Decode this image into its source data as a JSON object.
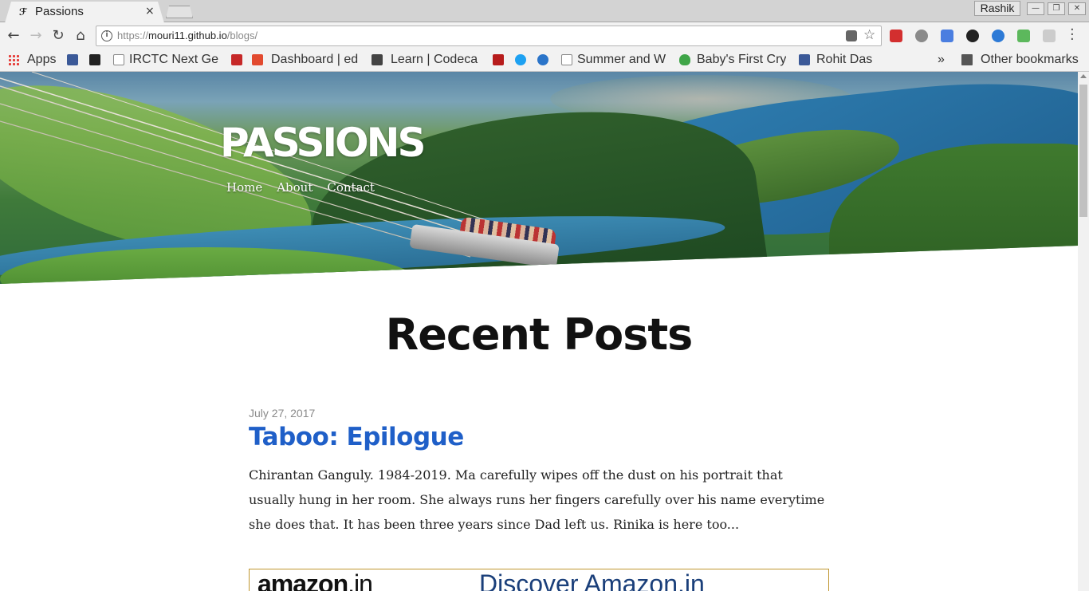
{
  "browser": {
    "tab": {
      "title": "Passions",
      "close": "×"
    },
    "profile_name": "Rashik",
    "window_controls": {
      "minimize": "—",
      "restore": "❐",
      "close": "✕"
    },
    "nav": {
      "back": "←",
      "forward": "→",
      "reload": "↻",
      "home": "⌂"
    },
    "url": {
      "scheme": "https://",
      "host": "mouri11.github.io",
      "path": "/blogs/"
    },
    "star": "☆",
    "bookmarks": {
      "apps": "Apps",
      "items": [
        "IRCTC Next Ge",
        "Dashboard | ed",
        "Learn | Codeca",
        "Summer and Wi",
        "Baby's First Cry",
        "Rohit Das"
      ],
      "overflow": "»",
      "other": "Other bookmarks"
    }
  },
  "page": {
    "site_title": "PASSIONS",
    "nav": [
      "Home",
      "About",
      "Contact"
    ],
    "section_title": "Recent Posts",
    "posts": [
      {
        "date": "July 27, 2017",
        "title": "Taboo: Epilogue",
        "excerpt": "Chirantan Ganguly. 1984-2019. Ma carefully wipes off the dust on his portrait that usually hung in her room. She always runs her fingers carefully over his name everytime she does that. It has been three years since Dad left us. Rinika is here too..."
      }
    ],
    "ad": {
      "brand": "amazon",
      "brand_tld": ".in",
      "tagline": "Discover Amazon.in"
    }
  },
  "colors": {
    "link": "#1f5fc8",
    "title": "#111111",
    "date": "#8a8a8a",
    "ad_border": "#c0962f"
  }
}
